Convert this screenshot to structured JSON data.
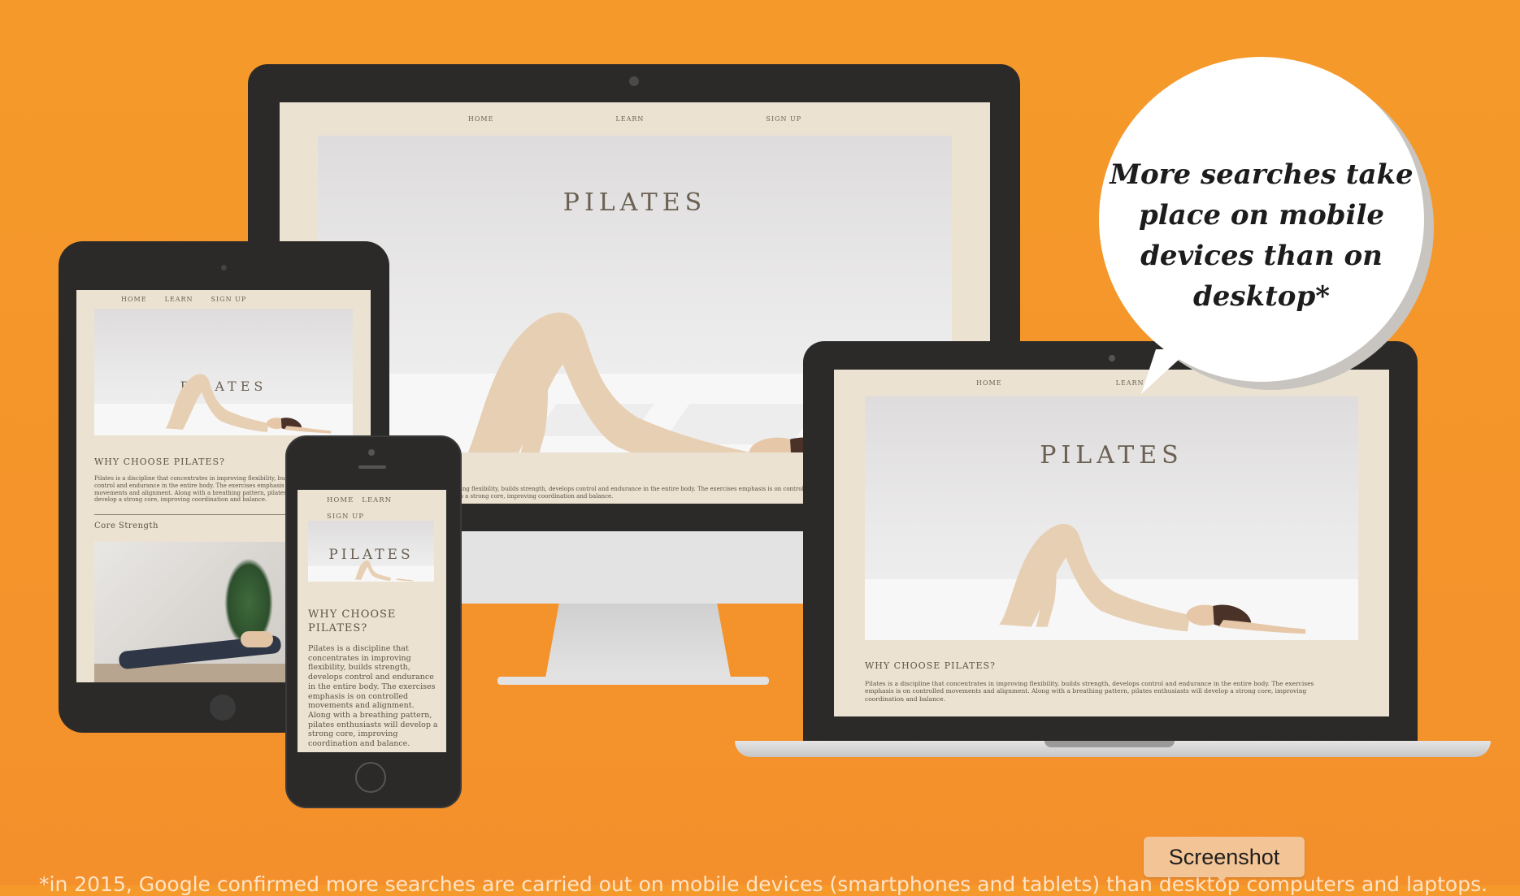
{
  "bubble": {
    "text": "More searches take place on mobile devices than on desktop*"
  },
  "footnote": {
    "text": "*in 2015, Google confirmed more searches are carried out on mobile devices (smartphones and tablets) than desktop computers and laptops."
  },
  "tooltip": {
    "label": "Screenshot"
  },
  "site": {
    "nav": {
      "home": "HOME",
      "learn": "LEARN",
      "signup": "SIGN UP"
    },
    "hero_title": "PILATES",
    "why_heading": "WHY CHOOSE PILATES?",
    "why_text": "Pilates is a discipline that concentrates in improving flexibility, builds strength, develops control and endurance in the entire body. The exercises emphasis is on controlled movements and alignment. Along with a breathing pattern, pilates enthusiasts will develop a strong core, improving coordination and balance.",
    "core_heading": "Core Strength"
  },
  "colors": {
    "background": "#f4962b",
    "device_body": "#2b2a29",
    "site_bg": "#ece2d2",
    "text": "#5d5347"
  }
}
